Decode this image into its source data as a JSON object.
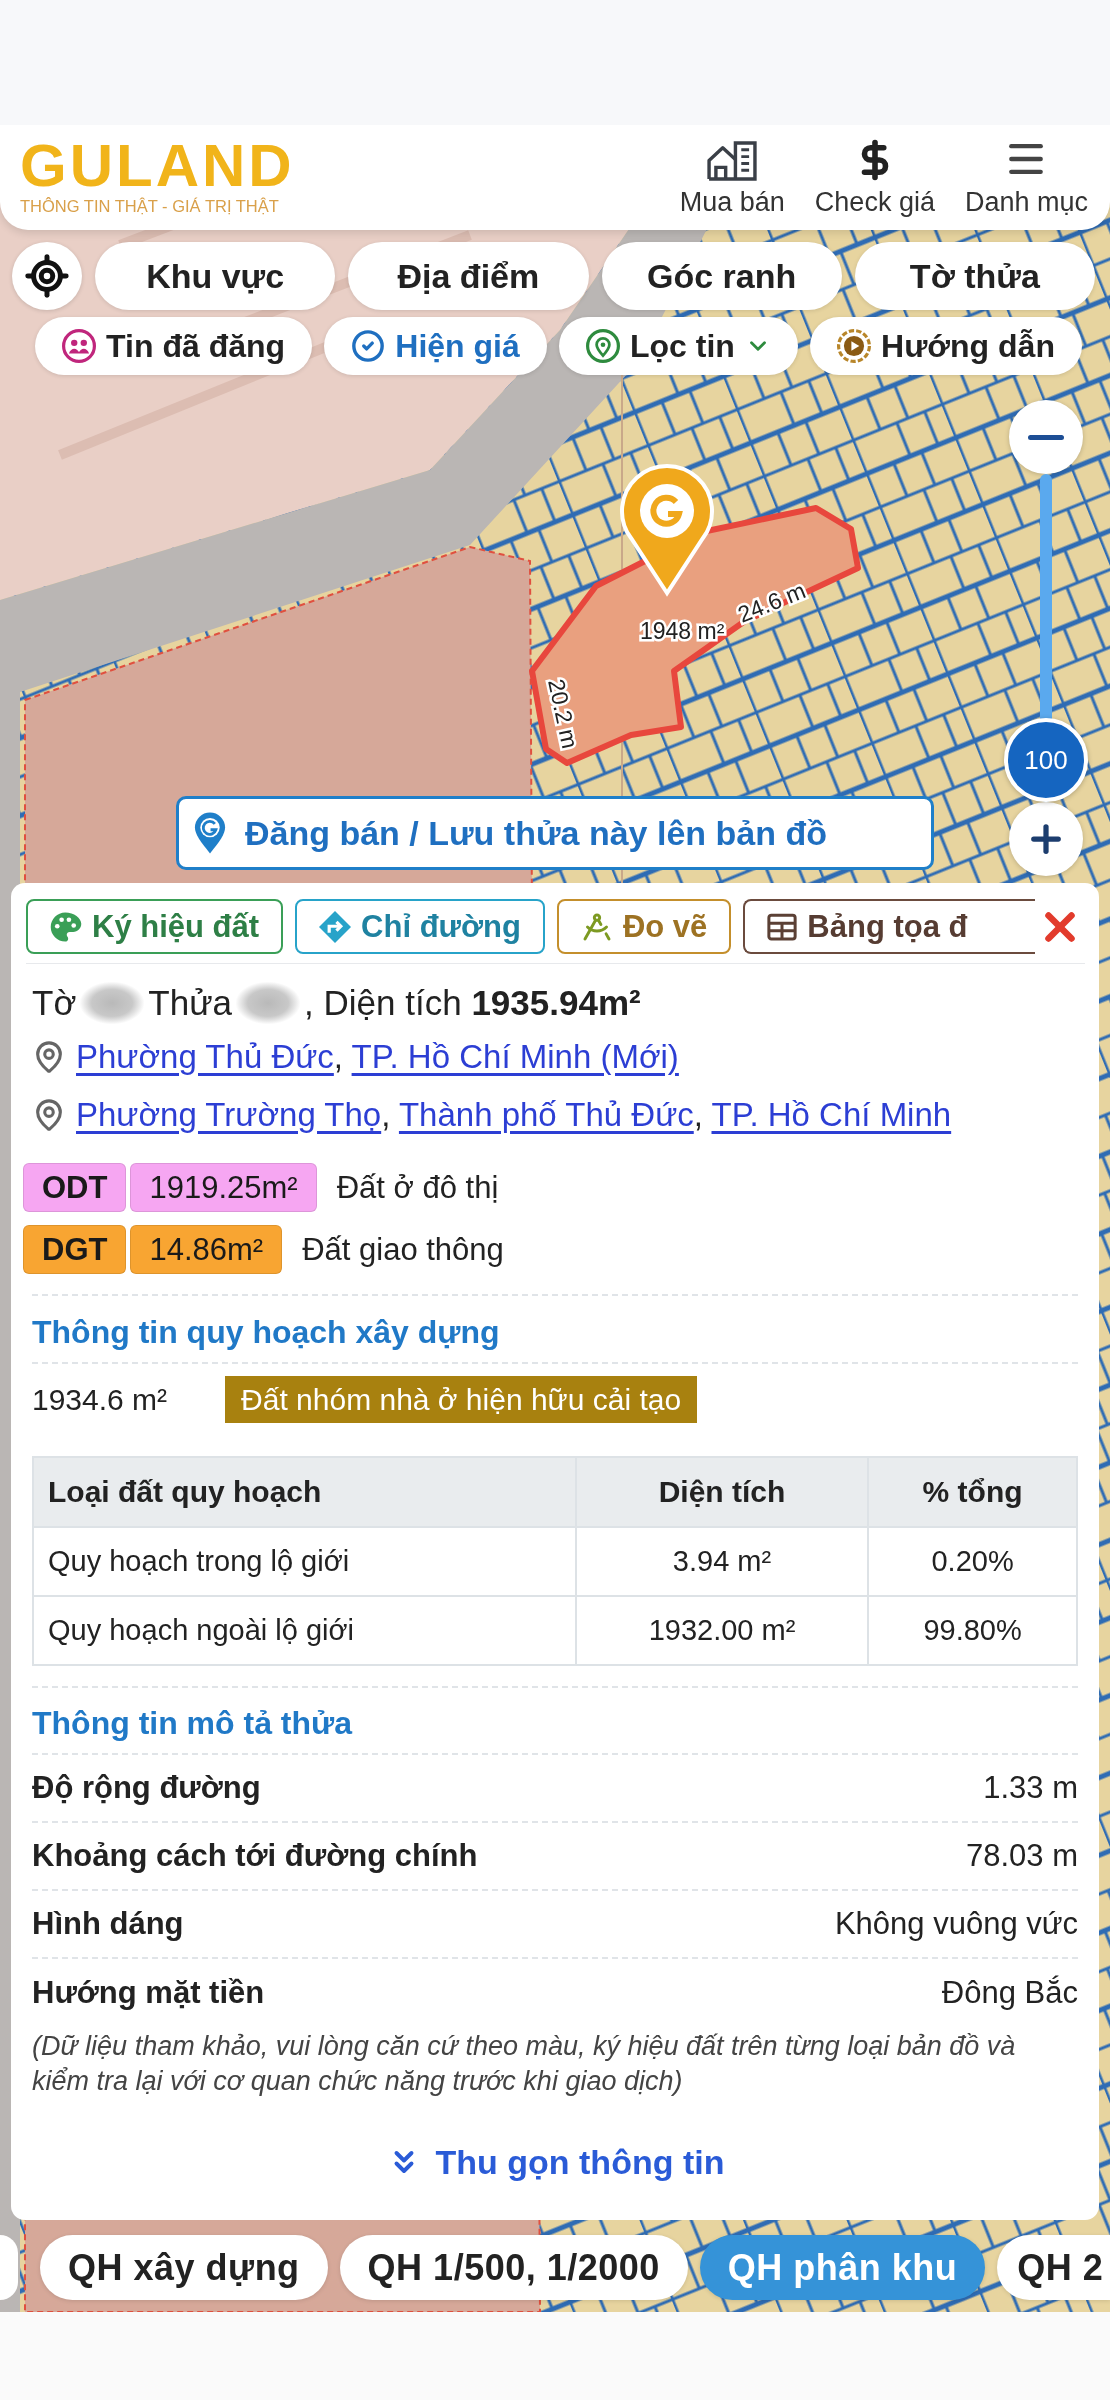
{
  "header": {
    "logo": "GULAND",
    "tagline": "THÔNG TIN THẬT - GIÁ TRỊ THẬT",
    "nav": [
      {
        "kind": "listings",
        "label": "Mua bán"
      },
      {
        "kind": "price",
        "label": "Check giá"
      },
      {
        "kind": "menu",
        "label": "Danh mục"
      }
    ]
  },
  "search_modes": [
    {
      "label": "Khu vực"
    },
    {
      "label": "Địa điểm"
    },
    {
      "label": "Góc ranh"
    },
    {
      "label": "Tờ thửa"
    }
  ],
  "filters": [
    {
      "kind": "posted",
      "label": "Tin đã đăng",
      "on": false
    },
    {
      "kind": "price",
      "label": "Hiện giá",
      "on": true
    },
    {
      "kind": "filter",
      "label": "Lọc tin",
      "on": false
    },
    {
      "kind": "guide",
      "label": "Hướng dẫn",
      "on": false
    }
  ],
  "map": {
    "area_label": "1948 m²",
    "edge_labels": [
      "24.6 m",
      "20.2 m"
    ],
    "zoom": {
      "level": 1,
      "reading": "100"
    },
    "post_button": "Đăng bán / Lưu thửa này lên bản đồ"
  },
  "parcel": {
    "tools": [
      {
        "kind": "legend",
        "label": "Ký hiệu đất",
        "color": "#3a9f57"
      },
      {
        "kind": "directions",
        "label": "Chỉ đường",
        "color": "#27a3c9"
      },
      {
        "kind": "measure",
        "label": "Đo vẽ",
        "color": "#c48f2c"
      },
      {
        "kind": "coordinates",
        "label": "Bảng tọa đ",
        "color": "#6b4b3e"
      }
    ],
    "title": {
      "sheet_label": "Tờ",
      "plot_label": "Thửa",
      "area": ", Diện tích **1935.94m²**"
    },
    "addresses": [
      {
        "separator": ", ",
        "links": [
          "Phường Thủ Đức",
          "TP. Hồ Chí Minh (Mới)"
        ]
      },
      {
        "separator": ", ",
        "links": [
          "Phường Trường Thọ",
          "Thành phố Thủ Đức",
          "TP. Hồ Chí Minh"
        ]
      }
    ],
    "land_use": [
      {
        "code": "ODT",
        "area": "1919.25m²",
        "name": "Đất ở đô thị",
        "color": "#f6a6f2"
      },
      {
        "code": "DGT",
        "area": "14.86m²",
        "name": "Đất giao thông",
        "color": "#f8a532"
      }
    ],
    "planning": {
      "title": "Thông tin quy hoạch xây dựng",
      "area": "1934.6 m²",
      "zone": "Đất nhóm nhà ở hiện hữu cải tạo",
      "table": {
        "columns": [
          "Loại đất quy hoạch",
          "Diện tích",
          "% tổng"
        ],
        "rows": [
          [
            "Quy hoạch trong lộ giới",
            "3.94 m²",
            "0.20%"
          ],
          [
            "Quy hoạch ngoài lộ giới",
            "1932.00 m²",
            "99.80%"
          ]
        ]
      }
    },
    "description": {
      "title": "Thông tin mô tả thửa",
      "rows": [
        {
          "label": "Độ rộng đường",
          "value": "1.33 m"
        },
        {
          "label": "Khoảng cách tới đường chính",
          "value": "78.03 m"
        },
        {
          "label": "Hình dáng",
          "value": "Không vuông vức"
        },
        {
          "label": "Hướng mặt tiền",
          "value": "Đông Bắc"
        }
      ],
      "note": "(Dữ liệu tham khảo, vui lòng căn cứ theo màu, ký hiệu đất trên từng loại bản đồ và kiểm tra lại với cơ quan chức năng trước khi giao dịch)"
    },
    "collapse_button": "Thu gọn thông tin"
  },
  "layers": [
    {
      "label": "QH xây dựng",
      "selected": false
    },
    {
      "label": "QH 1/500, 1/2000",
      "selected": false
    },
    {
      "label": "QH phân khu",
      "selected": true
    },
    {
      "label": "QH 2",
      "selected": false
    }
  ]
}
